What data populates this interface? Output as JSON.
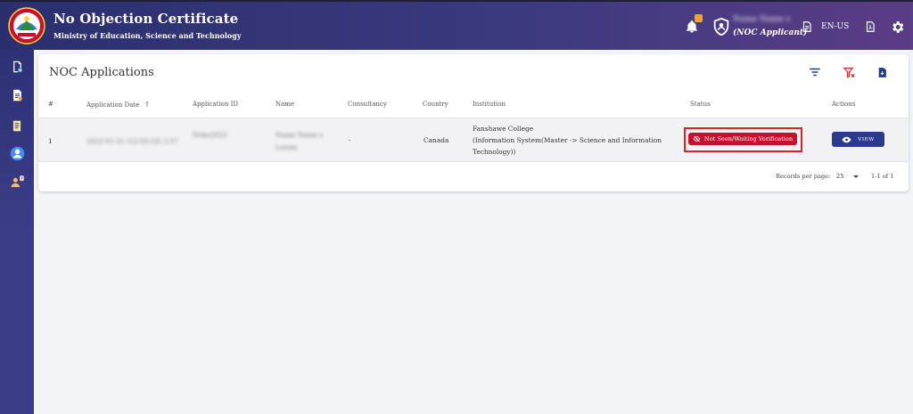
{
  "header": {
    "title": "No Objection Certificate",
    "subtitle": "Ministry of Education, Science and Technology",
    "user_name": "Name Name s",
    "user_role": "(NOC Applicant)",
    "language": "EN-US",
    "notification_badge": ""
  },
  "sidebar": {
    "items": [
      {
        "icon": "document-add-icon"
      },
      {
        "icon": "document-edit-icon"
      },
      {
        "icon": "document-list-icon"
      },
      {
        "icon": "user-circle-icon"
      },
      {
        "icon": "users-alert-icon"
      }
    ]
  },
  "card": {
    "title": "NOC Applications",
    "actions": [
      "filter-icon",
      "clear-filter-icon",
      "export-icon"
    ]
  },
  "table": {
    "columns": [
      "#",
      "Application Date",
      "Application ID",
      "Name",
      "Consultancy",
      "Country",
      "Institution",
      "Status",
      "Actions"
    ],
    "rows": [
      {
        "index": "1",
        "application_date": "2022-01-21 (12:50:33) 2:57",
        "application_id": "Nobo2022",
        "name_line1": "Name Name s",
        "name_line2": "Lorem",
        "consultancy": "-",
        "country": "Canada",
        "institution_line1": "Fanshawe College",
        "institution_line2": "(Information System(Master -> Science and Information",
        "institution_line3": "Technology))",
        "status": "Not Seen/Waiting Verification",
        "action": "VIEW"
      }
    ]
  },
  "pagination": {
    "records_label": "Records per page:",
    "per_page": "25",
    "range": "1-1 of 1"
  },
  "colors": {
    "header_start": "#2b2f6e",
    "header_end": "#5b3c86",
    "status_red": "#c8102e",
    "view_blue": "#2c3a8e",
    "action_icon_blue": "#1e3a8a",
    "clear_filter_red": "#d32f2f"
  }
}
